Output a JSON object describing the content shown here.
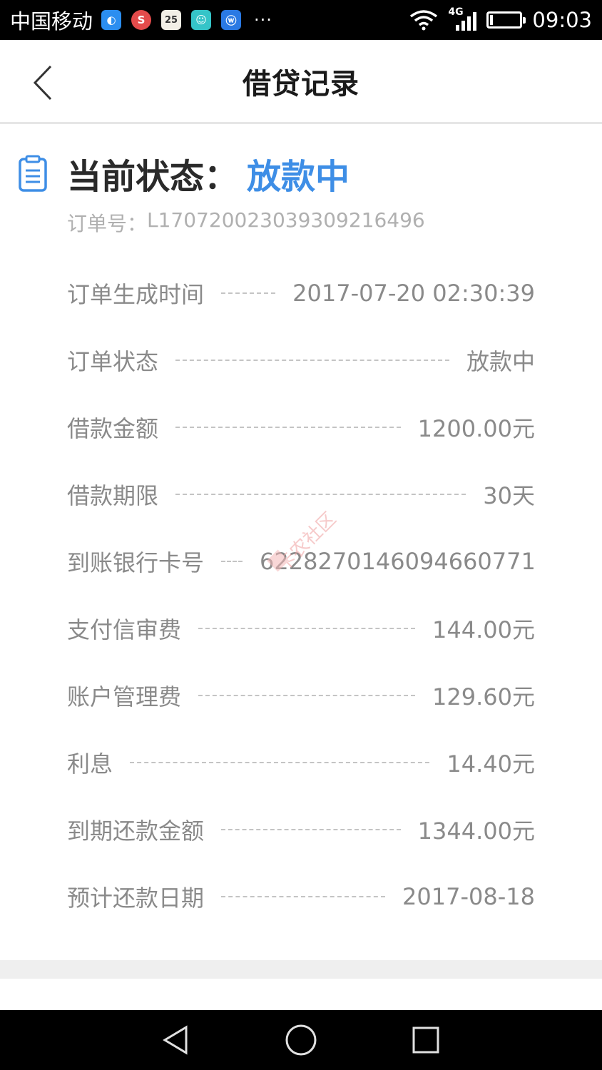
{
  "status_bar": {
    "carrier": "中国移动",
    "notif_icons": [
      {
        "icon": "browser-app-icon",
        "glyph": "◐"
      },
      {
        "icon": "sogou-app-icon",
        "glyph": "S"
      },
      {
        "icon": "calendar-app-icon",
        "glyph": "25"
      },
      {
        "icon": "chat-app-icon",
        "glyph": "☺"
      },
      {
        "icon": "wireless-app-icon",
        "glyph": "ⓦ"
      }
    ],
    "more": "···",
    "network": "4G",
    "time": "09:03"
  },
  "header": {
    "title": "借贷记录"
  },
  "status": {
    "label": "当前状态：",
    "value": "放款中",
    "value_color": "#3e8ee6"
  },
  "order": {
    "label": "订单号：",
    "number": "L17072002303930921​6496"
  },
  "details": [
    {
      "label": "订单生成时间",
      "value": "2017-07-20 02:30:39"
    },
    {
      "label": "订单状态",
      "value": "放款中"
    },
    {
      "label": "借款金额",
      "value": "1200.00元"
    },
    {
      "label": "借款期限",
      "value": "30天"
    },
    {
      "label": "到账银行卡号",
      "value": "6228270146094660771"
    },
    {
      "label": "支付信审费",
      "value": "144.00元"
    },
    {
      "label": "账户管理费",
      "value": "129.60元"
    },
    {
      "label": "利息",
      "value": "14.40元"
    },
    {
      "label": "到期还款金额",
      "value": "1344.00元"
    },
    {
      "label": "预计还款日期",
      "value": "2017-08-18"
    }
  ],
  "watermark": {
    "text": "卡农社区"
  }
}
